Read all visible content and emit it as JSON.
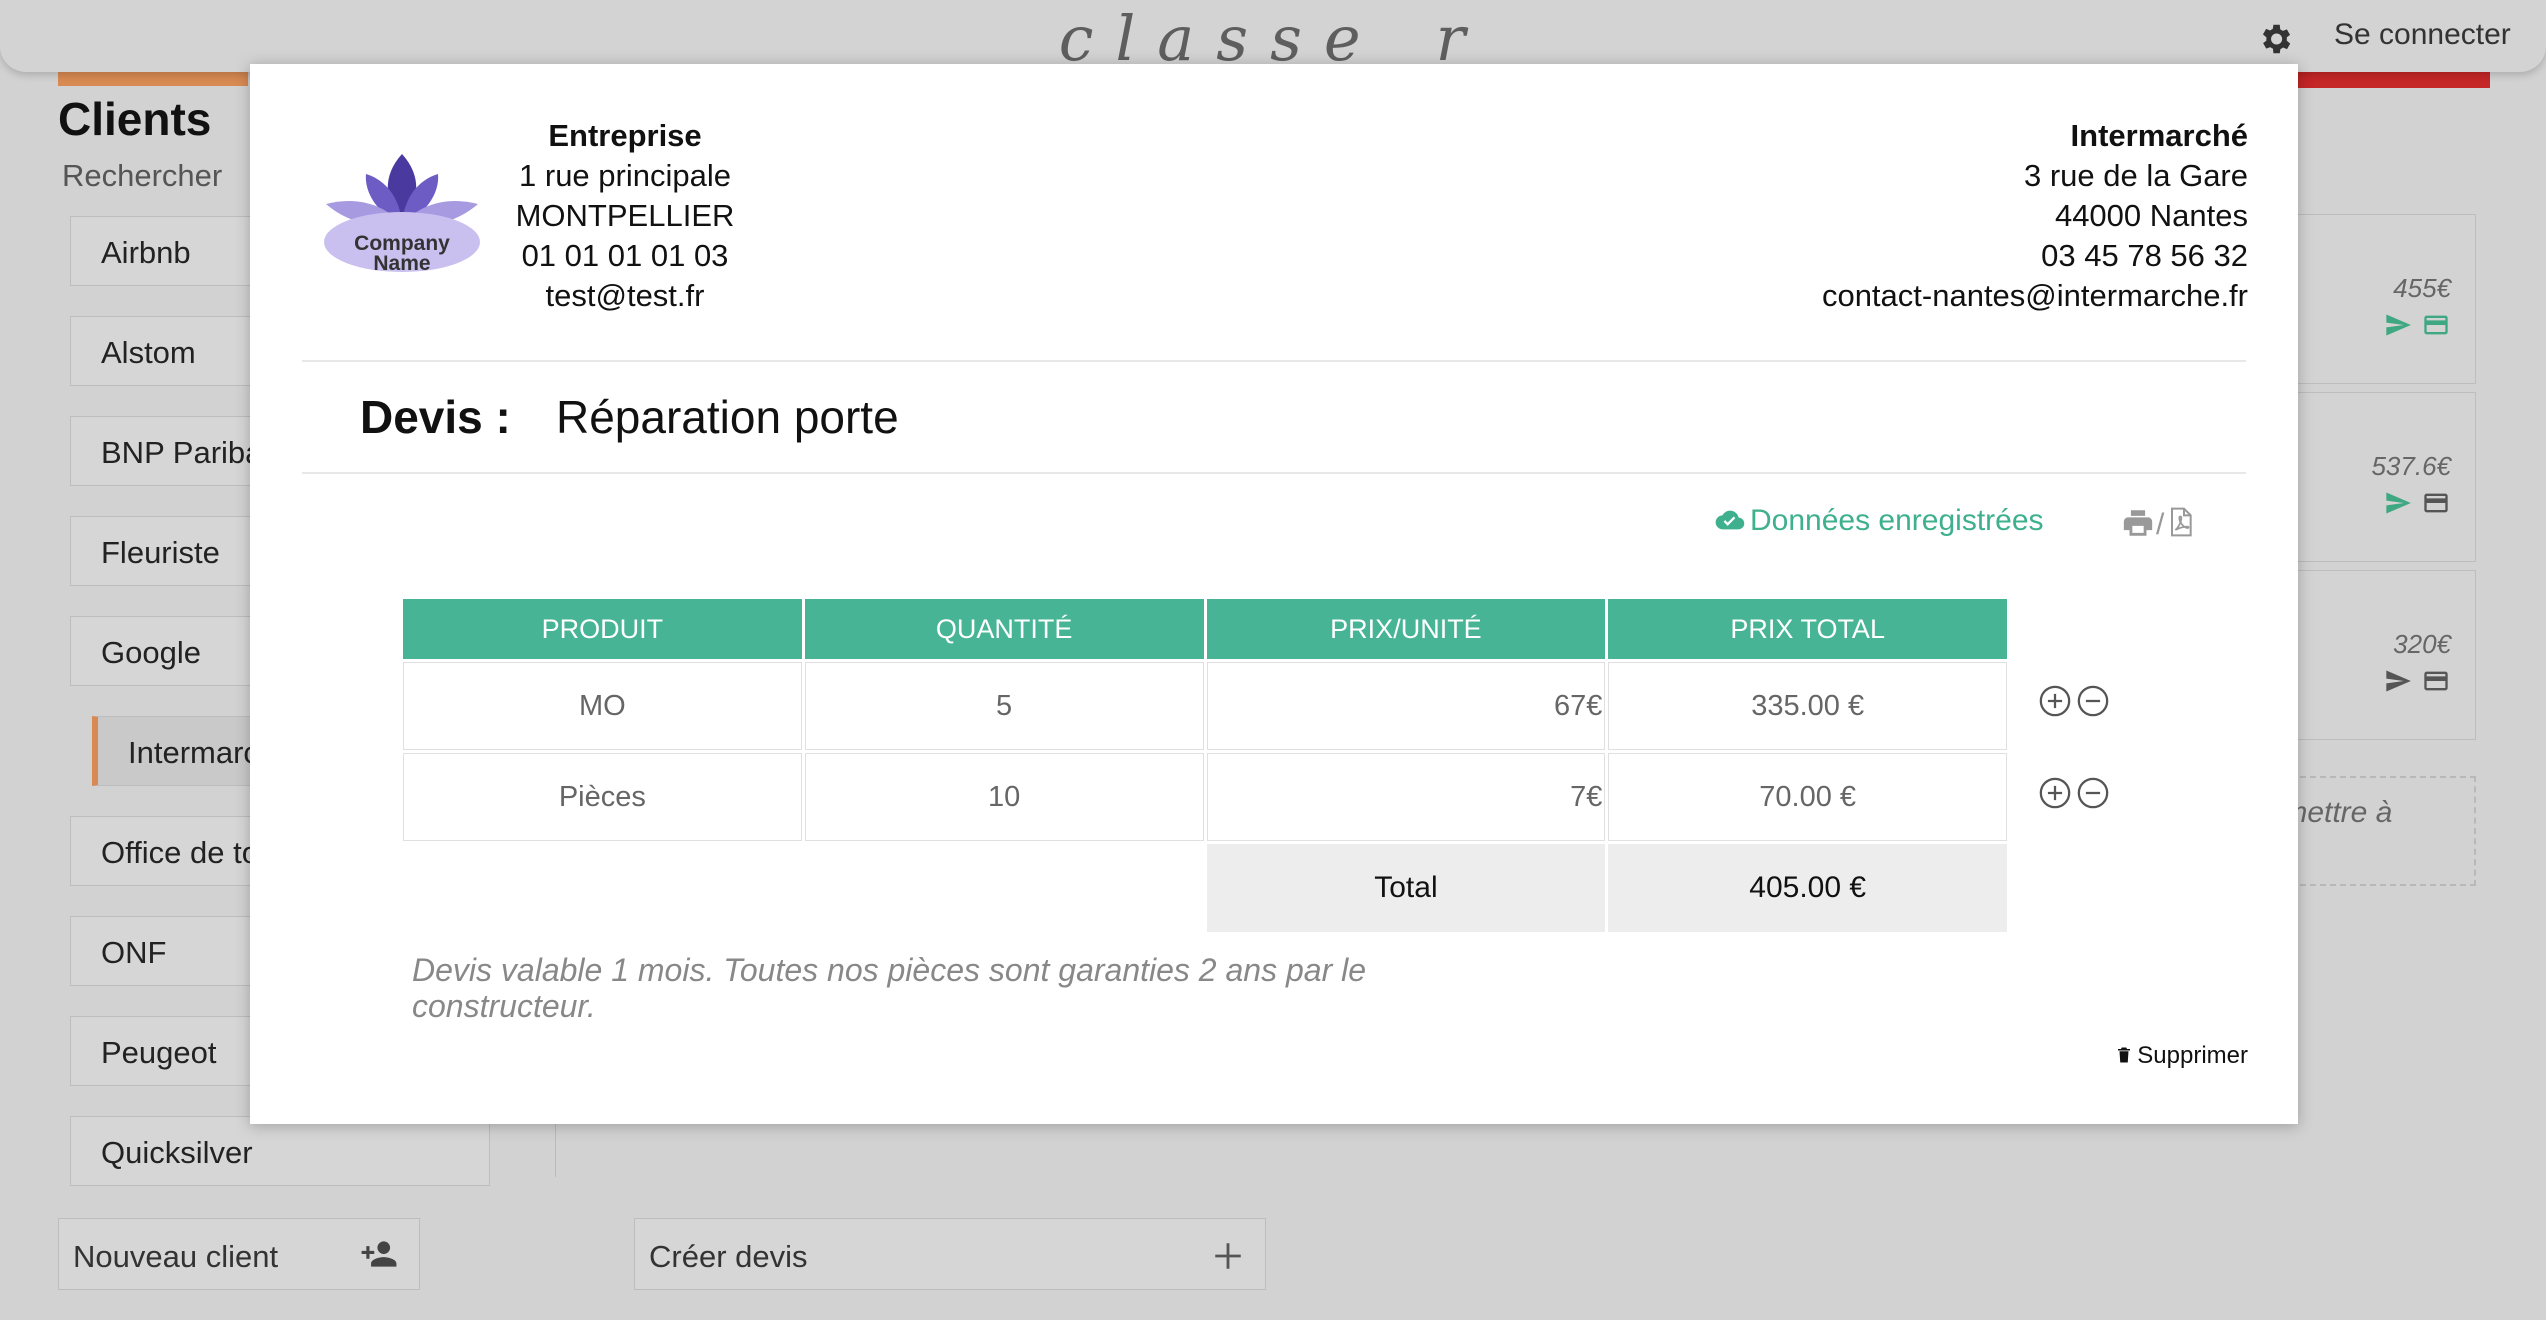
{
  "app": {
    "brand": "classe_r",
    "login_label": "Se connecter"
  },
  "sidebar": {
    "title": "Clients",
    "search_label": "Rechercher",
    "clients": [
      "Airbnb",
      "Alstom",
      "BNP Paribas",
      "Fleuriste",
      "Google",
      "Intermarché",
      "Office de tourisme",
      "ONF",
      "Peugeot",
      "Quicksilver"
    ],
    "active_client": "Intermarché"
  },
  "quote_cards": [
    {
      "amount": "455€"
    },
    {
      "amount": "537.6€"
    },
    {
      "amount": "320€"
    }
  ],
  "drop_zone_text": "r mettre à",
  "bottom": {
    "new_client": "Nouveau client",
    "create_quote": "Créer devis"
  },
  "modal": {
    "company": {
      "logo_text_1": "Company",
      "logo_text_2": "Name",
      "name": "Entreprise",
      "address": "1 rue principale",
      "city": "MONTPELLIER",
      "phone": "01 01 01 01 03",
      "email": "test@test.fr"
    },
    "client": {
      "name": "Intermarché",
      "address": "3 rue de la Gare",
      "city": "44000 Nantes",
      "phone": "03 45 78 56 32",
      "email": "contact-nantes@intermarche.fr"
    },
    "devis_label": "Devis :",
    "devis_title": "Réparation porte",
    "saved_status": "Données enregistrées",
    "print_separator": "/",
    "table": {
      "headers": [
        "PRODUIT",
        "QUANTITÉ",
        "PRIX/UNITÉ",
        "PRIX TOTAL"
      ],
      "rows": [
        {
          "product": "MO",
          "quantity": "5",
          "unit_price": "67€",
          "total": "335.00 €"
        },
        {
          "product": "Pièces",
          "quantity": "10",
          "unit_price": "7€",
          "total": "70.00 €"
        }
      ],
      "total_label": "Total",
      "total_value": "405.00 €"
    },
    "note": "Devis valable 1 mois. Toutes nos pièces sont garanties 2 ans par le constructeur.",
    "delete_label": "Supprimer"
  },
  "colors": {
    "accent": "#47b595",
    "brand_orange": "#d88a52",
    "brand_red": "#c52626",
    "logo_purple": "#5b4bb0"
  },
  "icons": [
    "gear-icon",
    "cloud-check-icon",
    "print-icon",
    "pdf-icon",
    "plus-circle-icon",
    "minus-circle-icon",
    "trash-icon",
    "send-icon",
    "card-icon",
    "add-user-icon",
    "plus-icon"
  ]
}
